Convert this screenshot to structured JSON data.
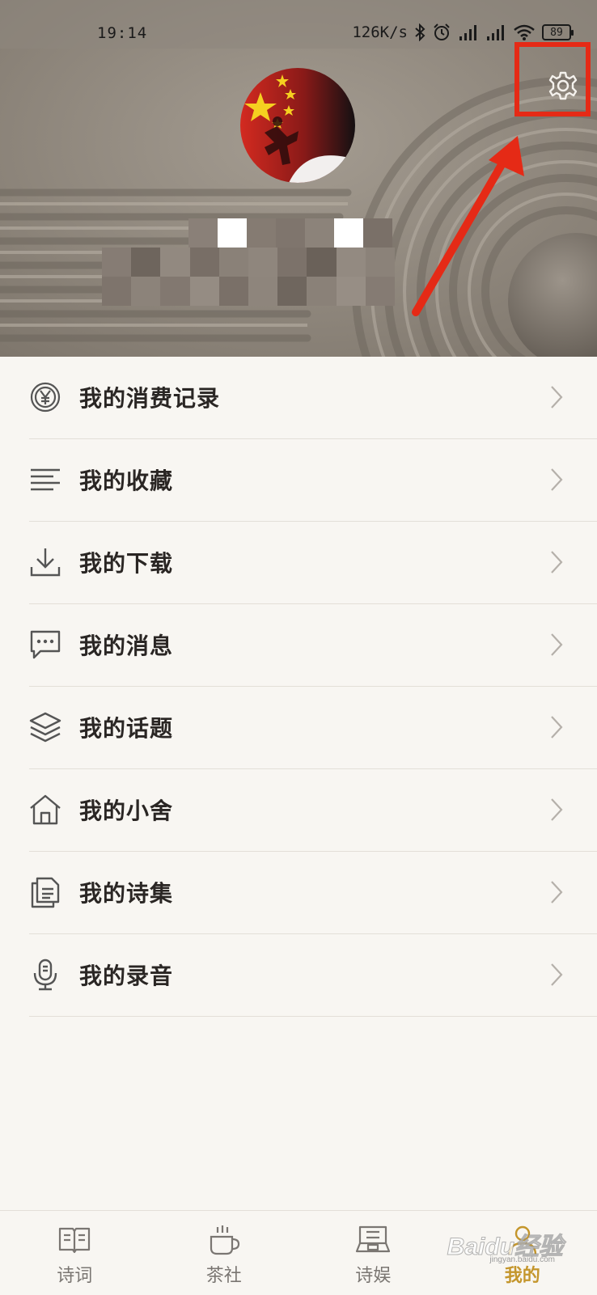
{
  "status_bar": {
    "time": "19:14",
    "speed": "126K/s",
    "battery": "89"
  },
  "header": {
    "settings_icon": "gear-icon",
    "annotation_color": "#e52a16"
  },
  "menu": {
    "items": [
      {
        "label": "我的消费记录",
        "icon": "yen-coin-icon"
      },
      {
        "label": "我的收藏",
        "icon": "list-lines-icon"
      },
      {
        "label": "我的下载",
        "icon": "download-icon"
      },
      {
        "label": "我的消息",
        "icon": "chat-bubble-icon"
      },
      {
        "label": "我的话题",
        "icon": "layers-icon"
      },
      {
        "label": "我的小舍",
        "icon": "house-icon"
      },
      {
        "label": "我的诗集",
        "icon": "documents-icon"
      },
      {
        "label": "我的录音",
        "icon": "microphone-icon"
      }
    ]
  },
  "bottom_nav": {
    "items": [
      {
        "label": "诗词",
        "icon": "book-icon"
      },
      {
        "label": "茶社",
        "icon": "tea-cup-icon"
      },
      {
        "label": "诗娱",
        "icon": "chess-board-icon"
      },
      {
        "label": "我的",
        "icon": "person-icon"
      }
    ],
    "active_index": 3,
    "active_color": "#c4962c"
  },
  "watermark": {
    "brand": "Baidu经验",
    "url": "jingyan.baidu.com"
  }
}
